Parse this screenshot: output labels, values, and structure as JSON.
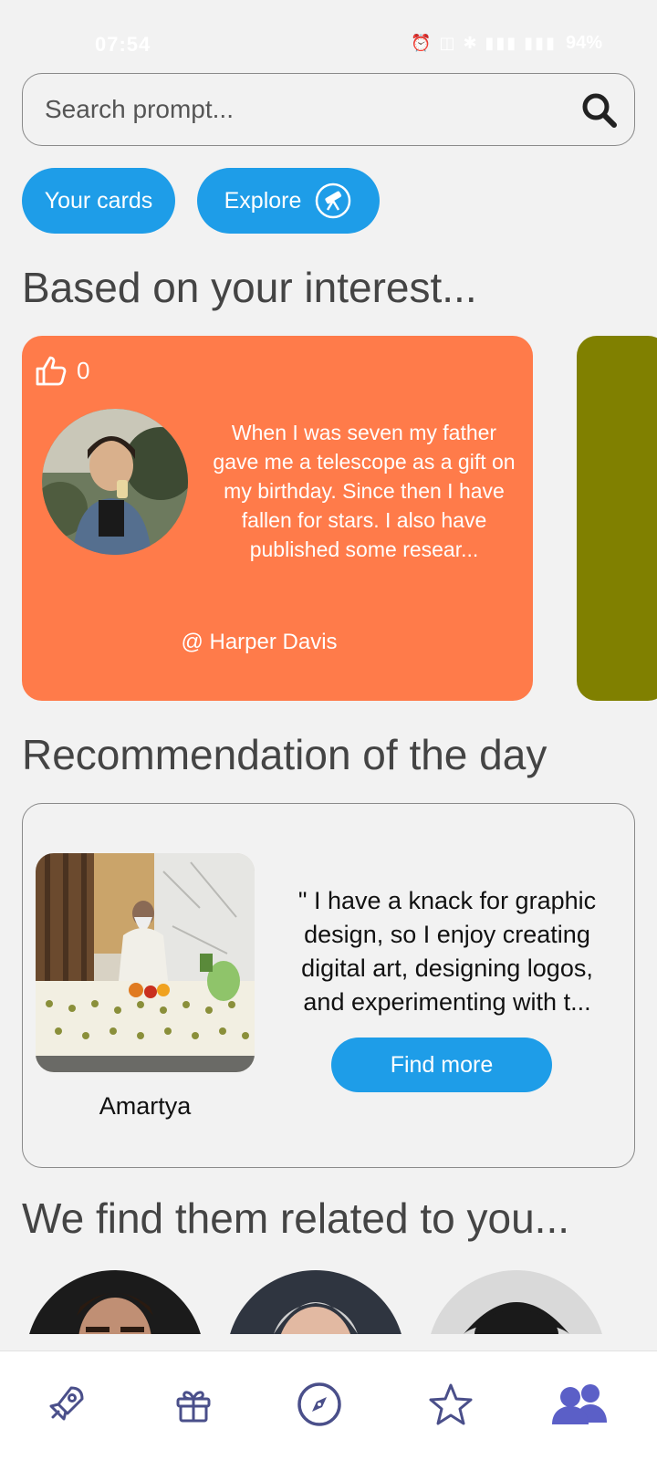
{
  "status": {
    "time": "07:54",
    "icons": "⏰ ◫ ✱ ▮▮▮ ▮▮▮",
    "battery": "94%"
  },
  "search": {
    "placeholder": "Search prompt..."
  },
  "chips": {
    "your_cards": "Your cards",
    "explore": "Explore"
  },
  "sections": {
    "interest_title": "Based on your interest...",
    "recommendation_title": "Recommendation of the day",
    "related_title": "We find them related to you..."
  },
  "interest_card": {
    "likes": "0",
    "text": "When I was seven my father gave me a telescope as a gift on my birthday. Since then I have fallen for stars. I also have published some resear...",
    "author": "@ Harper Davis",
    "color": "#ff7b4a",
    "next_card_color": "#808000"
  },
  "recommendation": {
    "name": "Amartya",
    "quote": "\" I have a knack for graphic design, so I enjoy creating digital art, designing logos, and experimenting with t...",
    "button": "Find more"
  },
  "bottom_nav": [
    "rocket-icon",
    "gift-icon",
    "compass-icon",
    "star-icon",
    "people-icon"
  ],
  "colors": {
    "accent": "#1e9de8",
    "nav_icon": "#4a4f8a",
    "nav_active": "#5b5fc7"
  }
}
